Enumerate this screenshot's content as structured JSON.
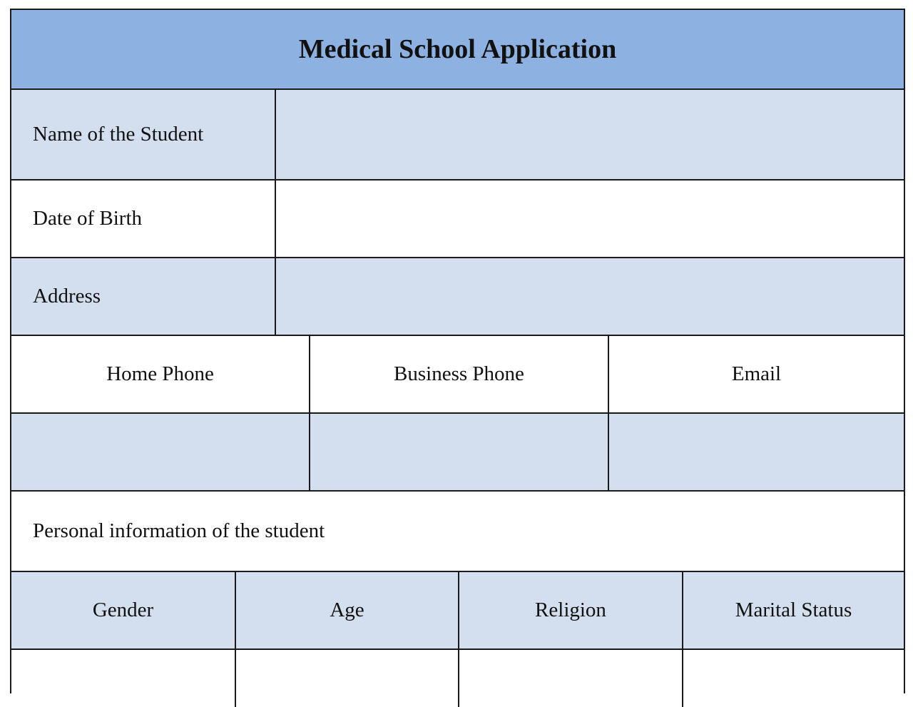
{
  "form": {
    "title": "Medical School Application",
    "fields": {
      "name_label": "Name of the Student",
      "name_value": "",
      "dob_label": "Date of Birth",
      "dob_value": "",
      "address_label": "Address",
      "address_value": ""
    },
    "contact": {
      "headers": [
        "Home Phone",
        "Business Phone",
        "Email"
      ],
      "values": [
        "",
        "",
        ""
      ]
    },
    "personal": {
      "section_label": "Personal information of the student",
      "headers": [
        "Gender",
        "Age",
        "Religion",
        "Marital Status"
      ],
      "values": [
        "",
        "",
        "",
        ""
      ]
    },
    "colors": {
      "header_blue": "#8db1e1",
      "row_light_blue": "#d3dfee",
      "border": "#1a1a1a"
    }
  }
}
